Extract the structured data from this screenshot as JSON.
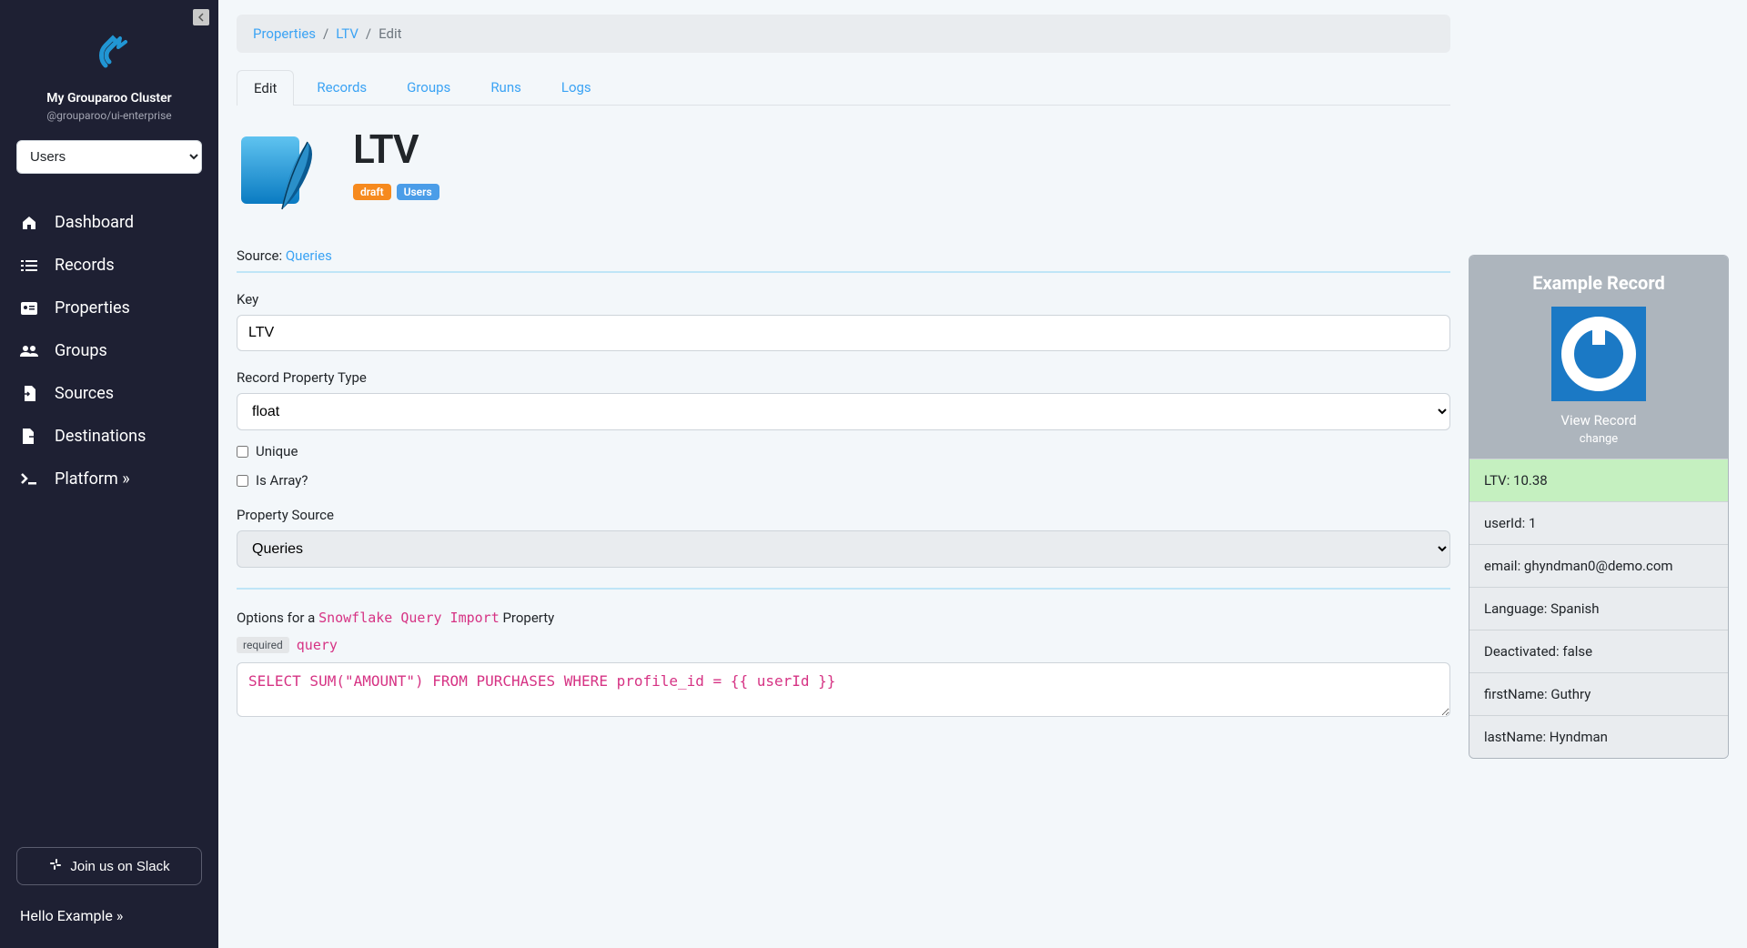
{
  "sidebar": {
    "cluster_name": "My Grouparoo Cluster",
    "cluster_sub": "@grouparoo/ui-enterprise",
    "select_value": "Users",
    "nav": [
      {
        "label": "Dashboard",
        "icon": "home"
      },
      {
        "label": "Records",
        "icon": "list"
      },
      {
        "label": "Properties",
        "icon": "id-card"
      },
      {
        "label": "Groups",
        "icon": "users"
      },
      {
        "label": "Sources",
        "icon": "file-import"
      },
      {
        "label": "Destinations",
        "icon": "file-export"
      },
      {
        "label": "Platform »",
        "icon": "terminal"
      }
    ],
    "slack_label": "Join us on Slack",
    "hello": "Hello Example »"
  },
  "breadcrumb": {
    "items": [
      "Properties",
      "LTV",
      "Edit"
    ]
  },
  "tabs": [
    "Edit",
    "Records",
    "Groups",
    "Runs",
    "Logs"
  ],
  "page": {
    "title": "LTV",
    "badge_draft": "draft",
    "badge_users": "Users",
    "source_label": "Source:",
    "source_link": "Queries",
    "key_label": "Key",
    "key_value": "LTV",
    "type_label": "Record Property Type",
    "type_value": "float",
    "unique_label": "Unique",
    "isarray_label": "Is Array?",
    "propsource_label": "Property Source",
    "propsource_value": "Queries",
    "options_prefix": "Options for a ",
    "options_code": "Snowflake Query Import",
    "options_suffix": " Property",
    "required_label": "required",
    "query_label": "query",
    "query_value": "SELECT SUM(\"AMOUNT\") FROM PURCHASES WHERE profile_id = {{ userId }}"
  },
  "record": {
    "title": "Example Record",
    "view_label": "View Record",
    "change_label": "change",
    "rows": [
      {
        "k": "LTV",
        "v": "10.38",
        "highlight": true
      },
      {
        "k": "userId",
        "v": "1"
      },
      {
        "k": "email",
        "v": "ghyndman0@demo.com"
      },
      {
        "k": "Language",
        "v": "Spanish"
      },
      {
        "k": "Deactivated",
        "v": "false"
      },
      {
        "k": "firstName",
        "v": "Guthry"
      },
      {
        "k": "lastName",
        "v": "Hyndman"
      }
    ]
  }
}
